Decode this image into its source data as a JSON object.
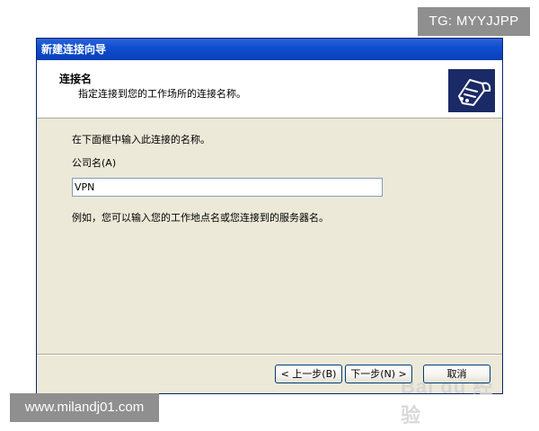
{
  "watermarks": {
    "tg": "TG: MYYJJPP",
    "site": "www.milandj01.com",
    "baidu": "Bai du 经验"
  },
  "dialog": {
    "title": "新建连接向导",
    "header": {
      "title": "连接名",
      "subtitle": "指定连接到您的工作场所的连接名称。"
    },
    "body": {
      "instruction": "在下面框中输入此连接的名称。",
      "company_label": "公司名(A)",
      "company_value": "VPN",
      "example": "例如，您可以输入您的工作地点名或您连接到的服务器名。"
    },
    "buttons": {
      "back": "< 上一步(B)",
      "next": "下一步(N) >",
      "cancel": "取消"
    }
  },
  "colors": {
    "titlebar": "#0a3fb8",
    "dialog_bg": "#ece9d8",
    "icon_bg": "#1a2a66"
  }
}
